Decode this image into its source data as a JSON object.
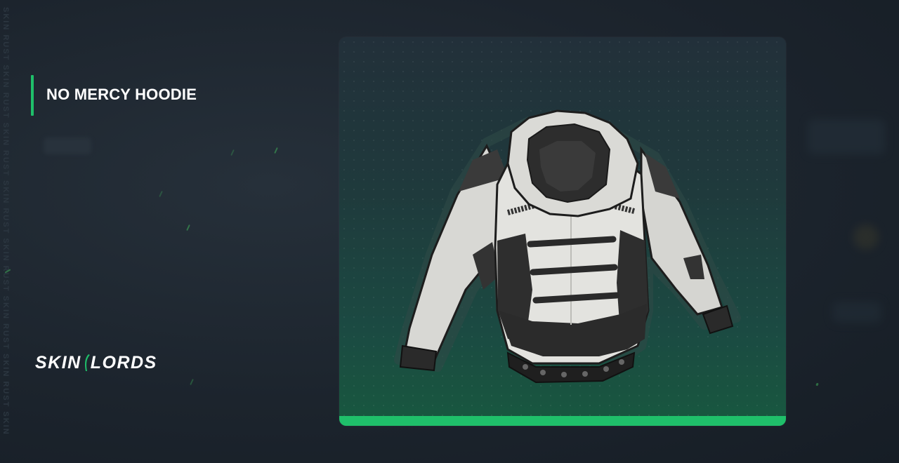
{
  "item": {
    "name": "NO MERCY HOODIE"
  },
  "brand": {
    "logo_left": "SKIN",
    "logo_right": "LORDS"
  },
  "watermark": {
    "text": "SKIN RUST SKIN RUST SKIN RUST SKIN RUST SKIN RUST SKIN RUST SKIN RUST SKIN"
  },
  "colors": {
    "accent": "#1fbf6a",
    "background": "#1c242d",
    "card_top": "#22303a",
    "card_bottom": "#18583f"
  },
  "icons": {
    "item_image": "hoodie-image",
    "logo_mark": "logo-slash-icon"
  }
}
